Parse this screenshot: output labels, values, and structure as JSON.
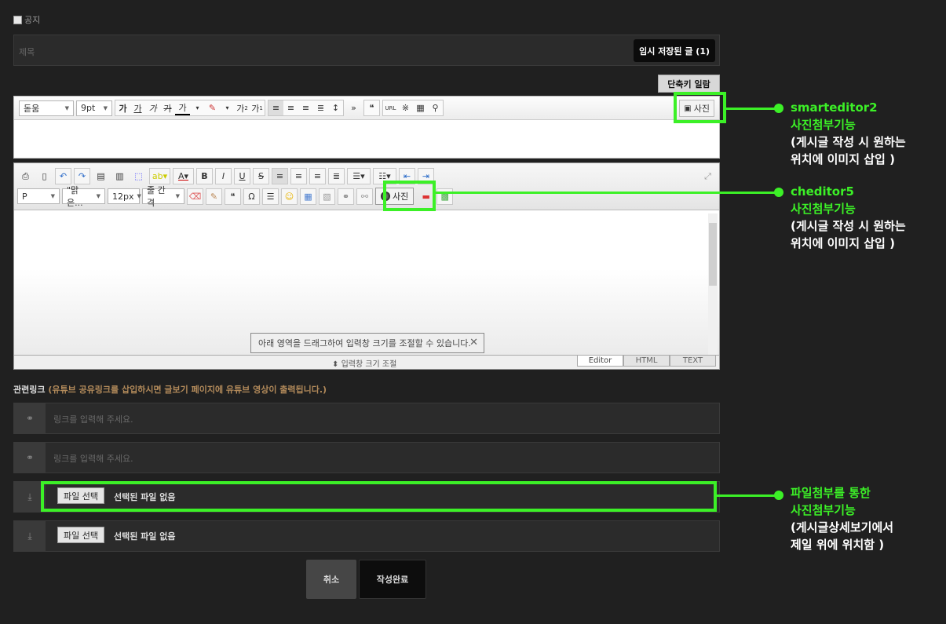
{
  "notice": {
    "label": "공지"
  },
  "title": {
    "placeholder": "제목",
    "draft_label": "임시 저장된 글 (1)"
  },
  "shortcut_label": "단축키 일람",
  "smarteditor": {
    "font": "돋움",
    "size": "9pt",
    "format_buttons": [
      "가",
      "가",
      "가",
      "가",
      "가"
    ],
    "sup": "가",
    "sub": "가",
    "more": "»",
    "url": "URL",
    "photo_label": "사진"
  },
  "cheditor": {
    "paragraph": "P",
    "font": "\"맑은...",
    "size": "12px",
    "line_height": "줄 간격",
    "photo_label": "사진",
    "resize_tip": "아래 영역을 드래그하여 입력창 크기를 조절할 수 있습니다.",
    "resize_bar": "입력창 크기 조절",
    "tabs": [
      "Editor",
      "HTML",
      "TEXT"
    ]
  },
  "links": {
    "label": "관련링크",
    "hint": "(유튜브 공유링크를 삽입하시면 글보기 페이지에 유튜브 영상이 출력됩니다.)",
    "placeholder": "링크를 입력해 주세요."
  },
  "files": {
    "button": "파일 선택",
    "status": "선택된 파일 없음"
  },
  "actions": {
    "cancel": "취소",
    "submit": "작성완료"
  },
  "annotations": [
    {
      "title": "smarteditor2",
      "subtitle": "사진첨부기능",
      "lines": [
        "(게시글 작성 시 원하는",
        "위치에 이미지 삽입 )"
      ]
    },
    {
      "title": "cheditor5",
      "subtitle": "사진첨부기능",
      "lines": [
        "(게시글 작성 시 원하는",
        "위치에 이미지 삽입 )"
      ]
    },
    {
      "title": "파일첨부를 통한",
      "subtitle": "사진첨부기능",
      "lines": [
        "(게시글상세보기에서",
        "제일 위에 위치함 )"
      ]
    }
  ],
  "colors": {
    "highlight": "#3cf027",
    "background": "#202020"
  }
}
